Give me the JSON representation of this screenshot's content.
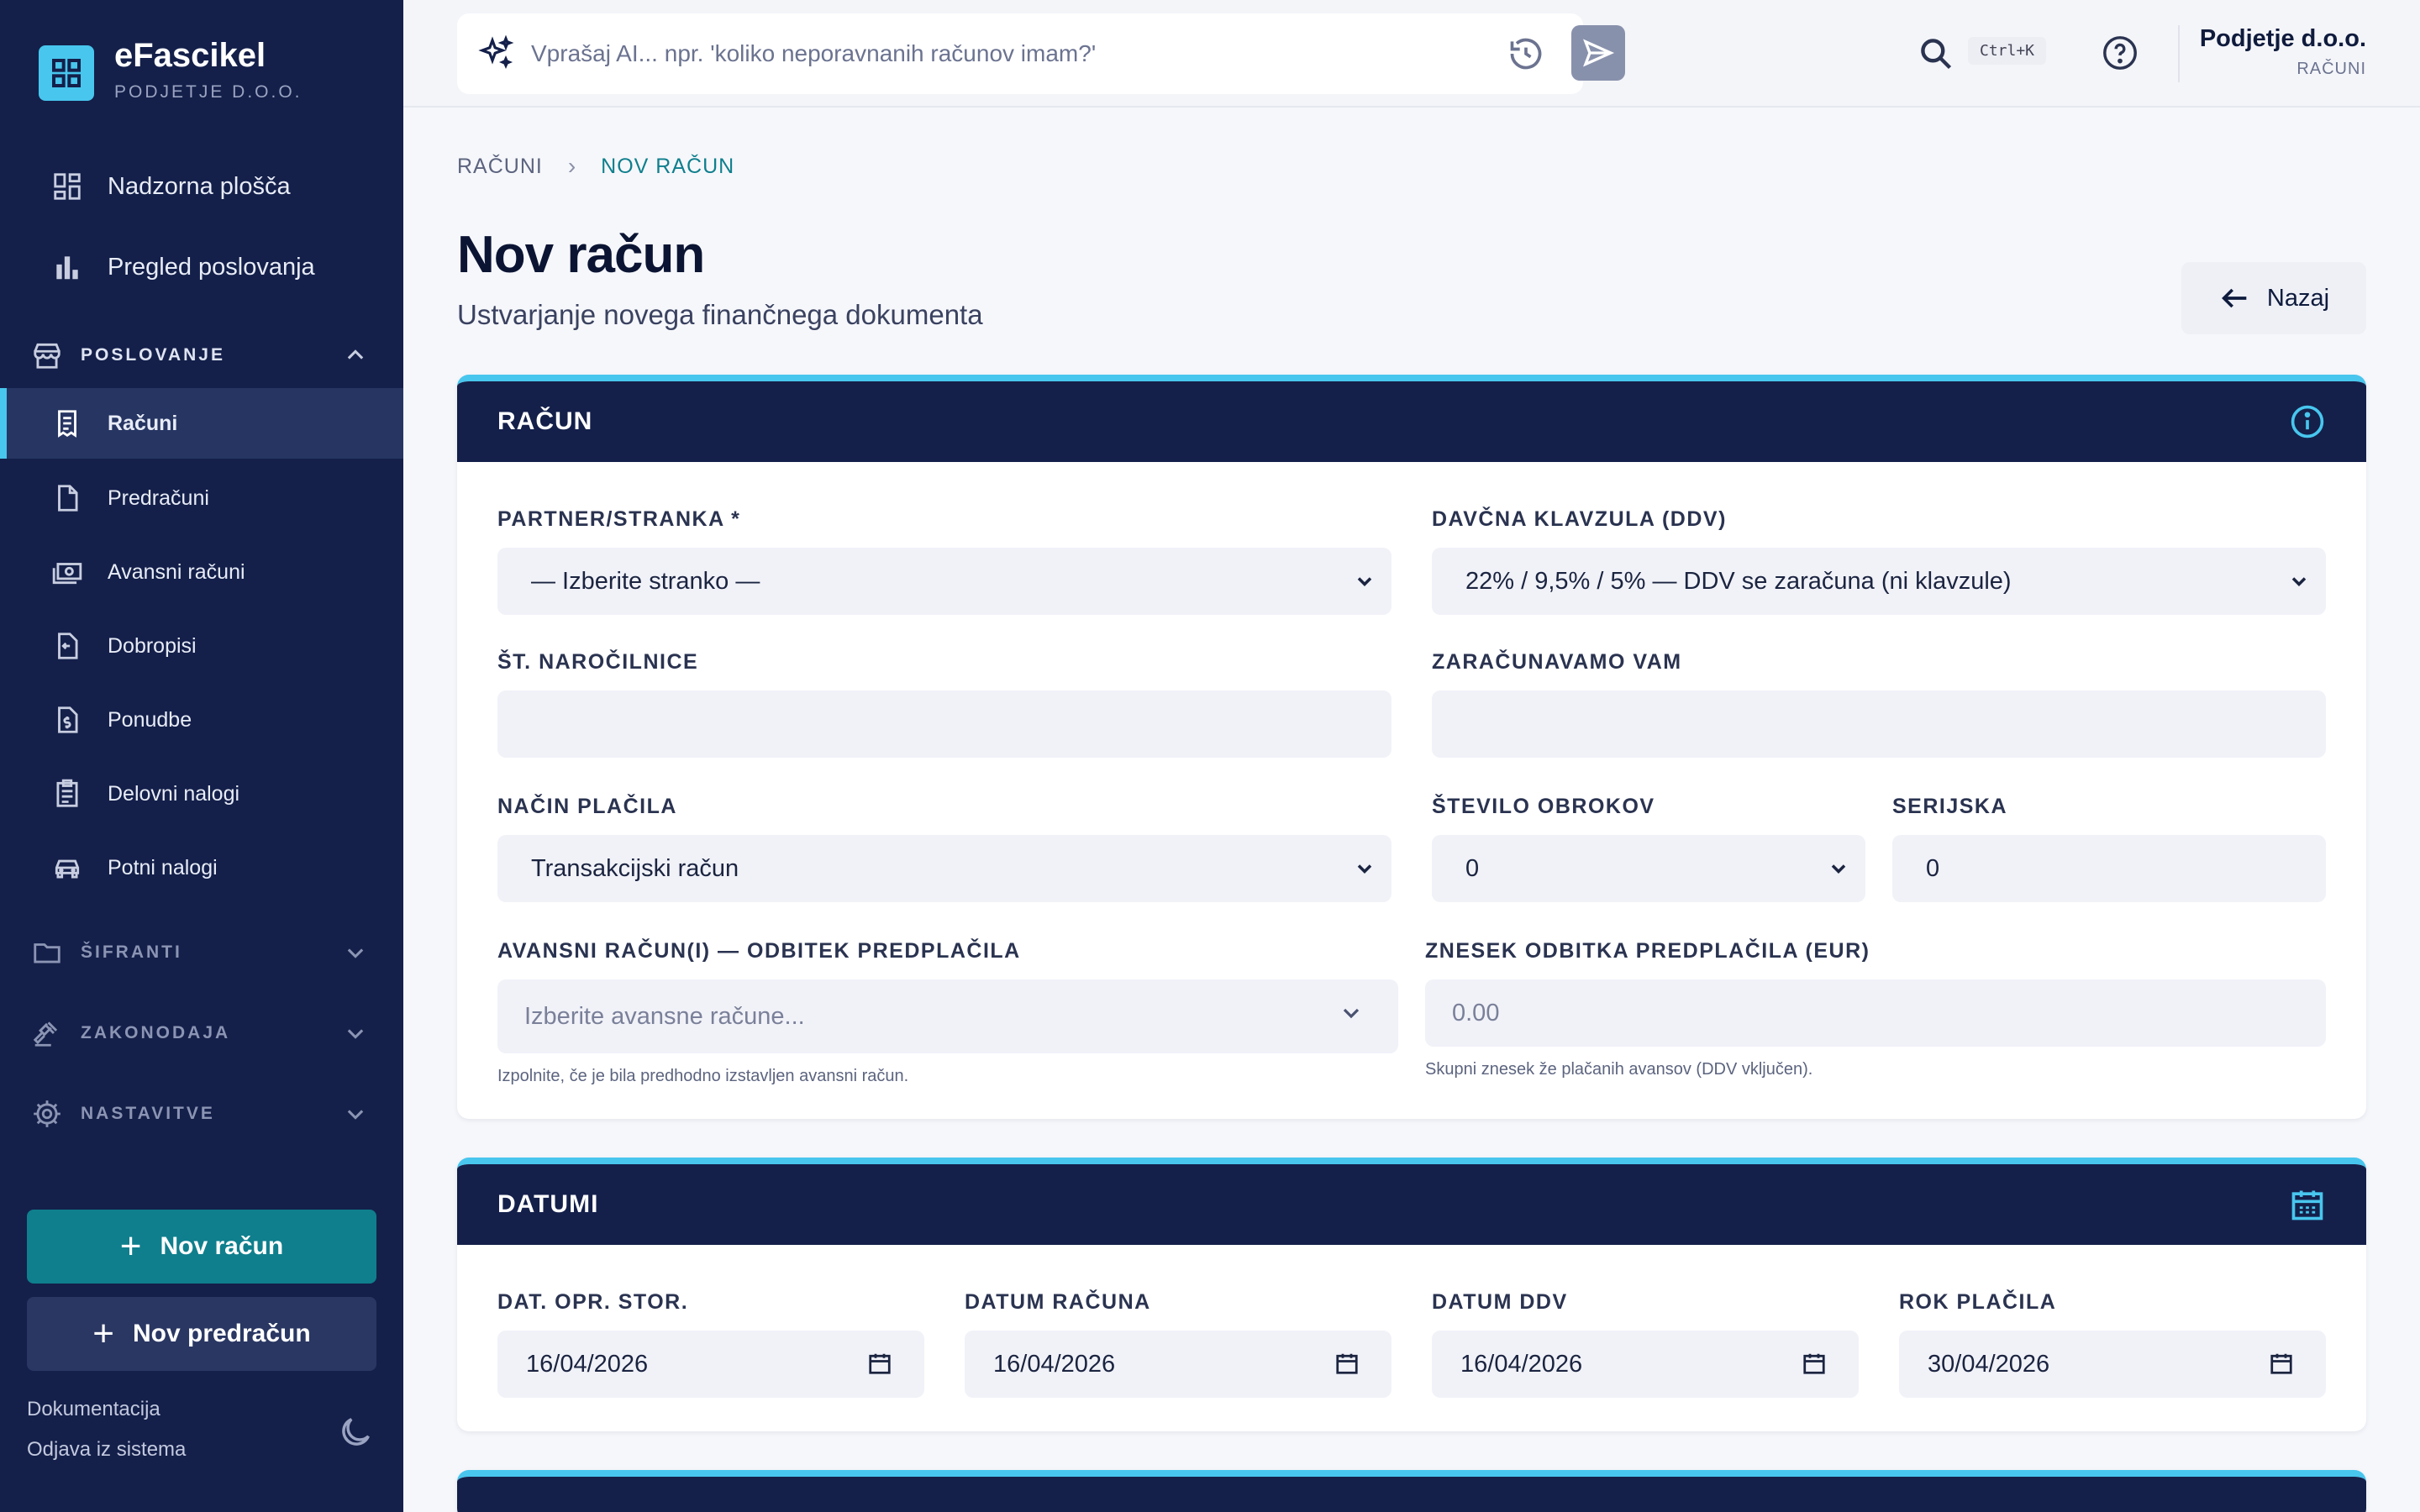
{
  "app": {
    "brand": "eFascikel",
    "brand_sub": "PODJETJE D.O.O."
  },
  "sidebar": {
    "top_items": [
      {
        "label": "Nadzorna plošča",
        "icon": "dashboard-icon"
      },
      {
        "label": "Pregled poslovanja",
        "icon": "bar-chart-icon"
      }
    ],
    "sections": {
      "poslovanje": {
        "label": "POSLOVANJE",
        "icon": "store-icon",
        "expanded": true
      },
      "sifranti": {
        "label": "ŠIFRANTI",
        "icon": "folder-icon",
        "expanded": false
      },
      "zakonodaja": {
        "label": "ZAKONODAJA",
        "icon": "gavel-icon",
        "expanded": false
      },
      "nastavitve": {
        "label": "NASTAVITVE",
        "icon": "gear-icon",
        "expanded": false
      }
    },
    "items": [
      {
        "label": "Računi",
        "icon": "receipt-icon",
        "active": true
      },
      {
        "label": "Predračuni",
        "icon": "document-icon"
      },
      {
        "label": "Avansni računi",
        "icon": "money-icon"
      },
      {
        "label": "Dobropisi",
        "icon": "credit-note-icon"
      },
      {
        "label": "Ponudbe",
        "icon": "offer-icon"
      },
      {
        "label": "Delovni nalogi",
        "icon": "clipboard-icon"
      },
      {
        "label": "Potni nalogi",
        "icon": "car-icon"
      }
    ],
    "buttons": {
      "new_invoice": "Nov račun",
      "new_proforma": "Nov predračun"
    },
    "links": {
      "docs": "Dokumentacija",
      "logout": "Odjava iz sistema"
    }
  },
  "topbar": {
    "ask_placeholder": "Vprašaj AI... npr. 'koliko neporavnanih računov imam?'",
    "shortcut": "Ctrl+K",
    "company_name": "Podjetje d.o.o.",
    "company_role": "RAČUNI"
  },
  "breadcrumb": {
    "parent": "RAČUNI",
    "current": "NOV RAČUN"
  },
  "page": {
    "title": "Nov račun",
    "subtitle": "Ustvarjanje novega finančnega dokumenta",
    "back": "Nazaj"
  },
  "invoice_card": {
    "title": "RAČUN",
    "partner_label": "PARTNER/STRANKA *",
    "partner_value": "— Izberite stranko —",
    "vat_label": "DAVČNA KLAVZULA (DDV)",
    "vat_value": "22% / 9,5% / 5% — DDV se zaračuna (ni klavzule)",
    "order_label": "ŠT. NAROČILNICE",
    "order_value": "",
    "charge_label": "ZARAČUNAVAMO VAM",
    "charge_value": "",
    "payment_label": "NAČIN PLAČILA",
    "payment_value": "Transakcijski račun",
    "installments_label": "ŠTEVILO OBROKOV",
    "installments_value": "0",
    "serial_label": "SERIJSKA",
    "serial_value": "0",
    "advance_label": "AVANSNI RAČUN(I) — ODBITEK PREDPLAČILA",
    "advance_placeholder": "Izberite avansne račune...",
    "advance_hint": "Izpolnite, če je bila predhodno izstavljen avansni račun.",
    "deduction_label": "ZNESEK ODBITKA PREDPLAČILA (EUR)",
    "deduction_placeholder": "0.00",
    "deduction_hint": "Skupni znesek že plačanih avansov (DDV vključen)."
  },
  "dates_card": {
    "title": "DATUMI",
    "fields": [
      {
        "label": "DAT. OPR. STOR.",
        "value": "16/04/2026"
      },
      {
        "label": "DATUM RAČUNA",
        "value": "16/04/2026"
      },
      {
        "label": "DATUM DDV",
        "value": "16/04/2026"
      },
      {
        "label": "ROK PLAČILA",
        "value": "30/04/2026"
      }
    ]
  },
  "colors": {
    "sidebar_bg": "#14204a",
    "accent": "#48c6ee",
    "primary_button": "#0f7f8d",
    "card_header": "#14204a"
  }
}
